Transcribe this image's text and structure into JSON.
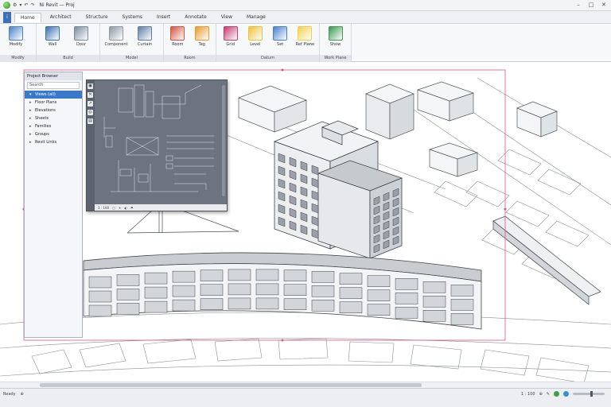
{
  "titlebar": {
    "quick_access": [
      "⚙",
      "▾",
      "↶",
      "↷"
    ],
    "title": "Ni Revit — Proj",
    "controls": [
      "–",
      "□",
      "✕"
    ]
  },
  "menu": {
    "items": [
      "Home",
      "Architect",
      "Structure",
      "Systems",
      "Insert",
      "Annotate",
      "View",
      "Manage"
    ]
  },
  "ribbon": {
    "groups": [
      {
        "name": "Modify",
        "buttons": [
          {
            "label": "Modify",
            "icon": "modify-icon",
            "color": "#4a82c9"
          }
        ]
      },
      {
        "name": "Build",
        "buttons": [
          {
            "label": "Wall",
            "icon": "wall-icon",
            "color": "#3b6fb6"
          },
          {
            "label": "Door",
            "icon": "door-icon",
            "color": "#7a8aa0"
          }
        ]
      },
      {
        "name": "Model",
        "buttons": [
          {
            "label": "Component",
            "icon": "component-icon",
            "color": "#8d99a8"
          },
          {
            "label": "Curtain",
            "icon": "curtain-icon",
            "color": "#5c7ea8"
          }
        ]
      },
      {
        "name": "Room",
        "buttons": [
          {
            "label": "Room",
            "icon": "room-icon",
            "color": "#d4543f"
          },
          {
            "label": "Tag",
            "icon": "tag-icon",
            "color": "#e89a2f"
          }
        ]
      },
      {
        "name": "Datum",
        "buttons": [
          {
            "label": "Grid",
            "icon": "grid-icon",
            "color": "#c83a6e"
          },
          {
            "label": "Level",
            "icon": "level-icon",
            "color": "#f0c23a"
          },
          {
            "label": "Set",
            "icon": "set-icon",
            "color": "#4a7fd0"
          },
          {
            "label": "Ref Plane",
            "icon": "ref-plane-icon",
            "color": "#f2d04a"
          }
        ]
      },
      {
        "name": "Work Plane",
        "buttons": [
          {
            "label": "Show",
            "icon": "show-icon",
            "color": "#3a9a4f"
          }
        ]
      }
    ]
  },
  "browser": {
    "header": "Project Browser",
    "search": "Search",
    "items": [
      {
        "label": "Views (all)",
        "selected": true
      },
      {
        "label": "Floor Plans",
        "selected": false
      },
      {
        "label": "Elevations",
        "selected": false
      },
      {
        "label": "Sheets",
        "selected": false
      },
      {
        "label": "Families",
        "selected": false
      },
      {
        "label": "Groups",
        "selected": false
      },
      {
        "label": "Revit Links",
        "selected": false
      }
    ]
  },
  "subview": {
    "tools": [
      "▣",
      "✕",
      "↗",
      "◎",
      "▤"
    ],
    "footer": [
      "1 : 100",
      "▢",
      "☀",
      "◐",
      "⚑"
    ]
  },
  "statusbar": {
    "left": [
      "Ready",
      "⊕"
    ],
    "right": [
      "1 : 100",
      "⊕",
      "✎"
    ],
    "indicator_colors": [
      "#3aa04a",
      "#3a8fd0"
    ]
  },
  "colors": {
    "accent": "#3a78c8",
    "crop_region": "#d4578a"
  }
}
